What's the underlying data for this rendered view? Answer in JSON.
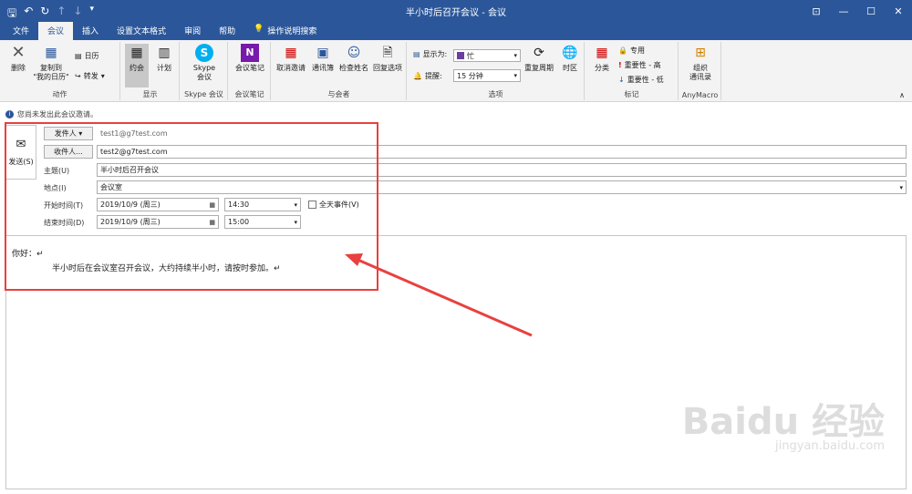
{
  "window": {
    "title": "半小时后召开会议 - 会议",
    "qat_icons": [
      "save-icon",
      "undo-icon",
      "redo-icon",
      "up-icon",
      "down-icon",
      "customize-icon"
    ],
    "controls": [
      "ribbon-display-icon",
      "minimize-icon",
      "maximize-icon",
      "close-icon"
    ]
  },
  "tabs": [
    {
      "label": "文件",
      "active": false
    },
    {
      "label": "会议",
      "active": true
    },
    {
      "label": "插入",
      "active": false
    },
    {
      "label": "设置文本格式",
      "active": false
    },
    {
      "label": "审阅",
      "active": false
    },
    {
      "label": "帮助",
      "active": false
    },
    {
      "label": "操作说明搜索",
      "active": false
    }
  ],
  "ribbon": {
    "groups": {
      "actions": "动作",
      "show": "显示",
      "skype": "Skype 会议",
      "notes": "会议笔记",
      "attendees": "与会者",
      "options": "选项",
      "tags": "标记",
      "anymacro": "AnyMacro"
    },
    "buttons": {
      "delete": "删除",
      "copy_to_calendar": "复制到\n\"我的日历\"",
      "calendar": "日历",
      "forward": "转发",
      "appointment": "约会",
      "scheduling": "计划",
      "skype_meeting": "Skype\n会议",
      "meeting_notes": "会议笔记",
      "cancel_invitation": "取消邀请",
      "address_book": "通讯簿",
      "check_names": "检查姓名",
      "response_options": "回复选项",
      "show_as_label": "显示为:",
      "show_as_value": "忙",
      "reminder_label": "提醒:",
      "reminder_value": "15 分钟",
      "recurrence": "重复周期",
      "time_zones": "时区",
      "categorize": "分类",
      "private": "专用",
      "high_importance": "重要性 - 高",
      "low_importance": "重要性 - 低",
      "org_address_book": "组织\n通讯录"
    }
  },
  "info_bar": "您尚未发出此会议邀请。",
  "form": {
    "send_label": "发送(S)",
    "from_button": "发件人 ▾",
    "from_value": "test1@g7test.com",
    "to_button": "收件人...",
    "to_value": "test2@g7test.com",
    "subject_label": "主题(U)",
    "subject_value": "半小时后召开会议",
    "location_label": "地点(I)",
    "location_value": "会议室",
    "start_label": "开始时间(T)",
    "start_date": "2019/10/9 (周三)",
    "start_time": "14:30",
    "all_day_label": "全天事件(V)",
    "end_label": "结束时间(D)",
    "end_date": "2019/10/9 (周三)",
    "end_time": "15:00"
  },
  "body": {
    "greeting": "你好：↵",
    "line1": "半小时后在会议室召开会议，大约持续半小时，请按时参加。↵"
  },
  "watermark": {
    "brand": "Baidu 经验",
    "url": "jingyan.baidu.com"
  },
  "colors": {
    "title_bar": "#2b579a",
    "ribbon_bg": "#f3f3f3",
    "highlight_red": "#e8413f"
  }
}
